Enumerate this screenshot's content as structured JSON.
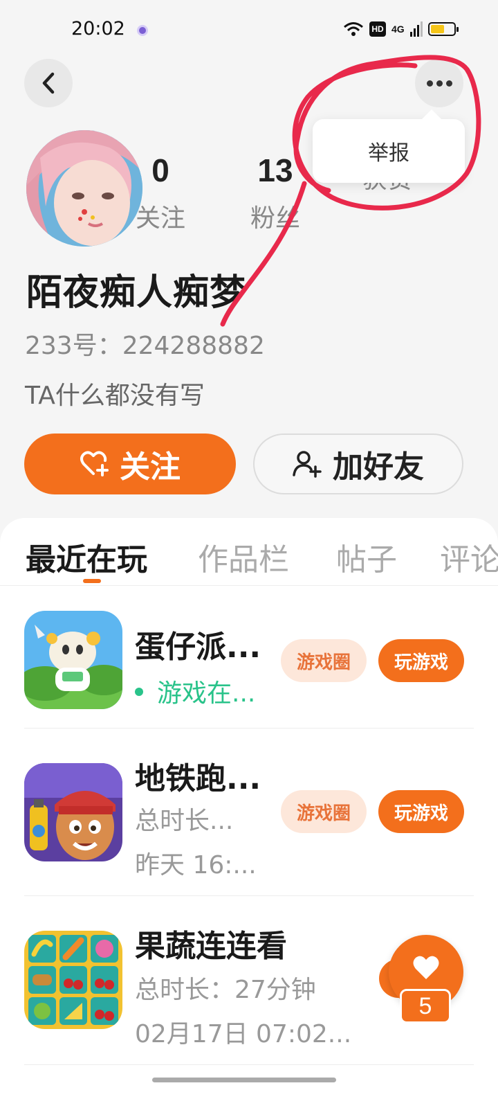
{
  "status_bar": {
    "time": "20:02",
    "hd": "HD",
    "network": "4G",
    "battery_level": 0.6
  },
  "header": {
    "back_icon": "chevron-left-icon",
    "more_icon": "more-dots-icon",
    "menu": {
      "report": "举报"
    }
  },
  "profile": {
    "stats": [
      {
        "value": "0",
        "label": "关注"
      },
      {
        "value": "13",
        "label": "粉丝"
      },
      {
        "value": "",
        "label": "获赞"
      }
    ],
    "name": "陌夜痴人痴梦",
    "id_line": "233号：224288882",
    "bio": "TA什么都没有写",
    "follow_label": "关注",
    "add_friend_label": "加好友"
  },
  "tabs": [
    {
      "label": "最近在玩",
      "active": true
    },
    {
      "label": "作品栏",
      "active": false
    },
    {
      "label": "帖子",
      "active": false
    },
    {
      "label": "评论",
      "active": false
    }
  ],
  "games": [
    {
      "title": "蛋仔派...",
      "lines": [
        "游戏在..."
      ],
      "online": true,
      "circle_label": "游戏圈",
      "play_label": "玩游戏"
    },
    {
      "title": "地铁跑...",
      "lines": [
        "总时长...",
        "昨天 16:..."
      ],
      "online": false,
      "circle_label": "游戏圈",
      "play_label": "玩游戏"
    },
    {
      "title": "果蔬连连看",
      "lines": [
        "总时长：27分钟",
        "02月17日 07:02..."
      ],
      "online": false
    }
  ],
  "floating_like": {
    "icon": "heart-icon",
    "count": "5"
  },
  "colors": {
    "accent": "#f36f1c",
    "online": "#29c38a",
    "annotation": "#e8294b"
  }
}
